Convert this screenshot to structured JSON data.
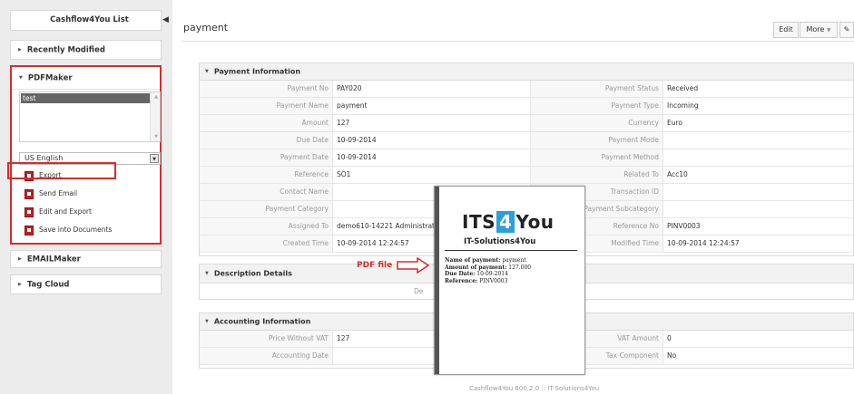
{
  "sidebar": {
    "title": "Cashflow4You List",
    "recently_modified": "Recently Modified",
    "pdfmaker": {
      "header": "PDFMaker",
      "templates": [
        "test"
      ],
      "language": "US English",
      "actions": [
        "Export",
        "Send Email",
        "Edit and Export",
        "Save into Documents"
      ]
    },
    "emailmaker": "EMAILMaker",
    "tag_cloud": "Tag Cloud"
  },
  "main": {
    "title": "payment",
    "buttons": {
      "edit": "Edit",
      "more": "More"
    },
    "payment_info": {
      "header": "Payment Information",
      "rows": [
        {
          "l1": "Payment No",
          "v1": "PAY020",
          "l2": "Payment Status",
          "v2": "Received"
        },
        {
          "l1": "Payment Name",
          "v1": "payment",
          "l2": "Payment Type",
          "v2": "Incoming"
        },
        {
          "l1": "Amount",
          "v1": "127",
          "l2": "Currency",
          "v2": "Euro"
        },
        {
          "l1": "Due Date",
          "v1": "10-09-2014",
          "l2": "Payment Mode",
          "v2": ""
        },
        {
          "l1": "Payment Date",
          "v1": "10-09-2014",
          "l2": "Payment Method",
          "v2": ""
        },
        {
          "l1": "Reference",
          "v1": "SO1",
          "l2": "Related To",
          "v2": "Acc10"
        },
        {
          "l1": "Contact Name",
          "v1": "",
          "l2": "Transaction ID",
          "v2": ""
        },
        {
          "l1": "Payment Category",
          "v1": "",
          "l2": "Payment Subcategory",
          "v2": ""
        },
        {
          "l1": "Assigned To",
          "v1": "demo610-14221 Administrator",
          "l2": "Reference No",
          "v2": "PINV0003"
        },
        {
          "l1": "Created Time",
          "v1": "10-09-2014 12:24:57",
          "l2": "Modified Time",
          "v2": "10-09-2014 12:24:57"
        }
      ]
    },
    "description": {
      "header": "Description Details",
      "label": "De"
    },
    "accounting": {
      "header": "Accounting Information",
      "rows": [
        {
          "l1": "Price Without VAT",
          "v1": "127",
          "l2": "VAT Amount",
          "v2": "0"
        },
        {
          "l1": "Accounting Date",
          "v1": "",
          "l2": "Tax Component",
          "v2": "No"
        }
      ]
    }
  },
  "pdf_preview": {
    "logo_left": "ITS",
    "logo_mid": "4",
    "logo_right": "You",
    "company": "IT-Solutions4You",
    "lines": [
      {
        "k": "Name of payment:",
        "v": "payment"
      },
      {
        "k": "Amount of payment:",
        "v": "127.000"
      },
      {
        "k": "Due Date:",
        "v": "10-09-2014"
      },
      {
        "k": "Reference:",
        "v": "PINV0003"
      }
    ],
    "label": "PDF file"
  },
  "footer": "Cashflow4You 600.2.0 :: IT-Solutions4You",
  "colors": {
    "highlight": "#d62b2b",
    "logo_blue": "#2a9fd8"
  }
}
